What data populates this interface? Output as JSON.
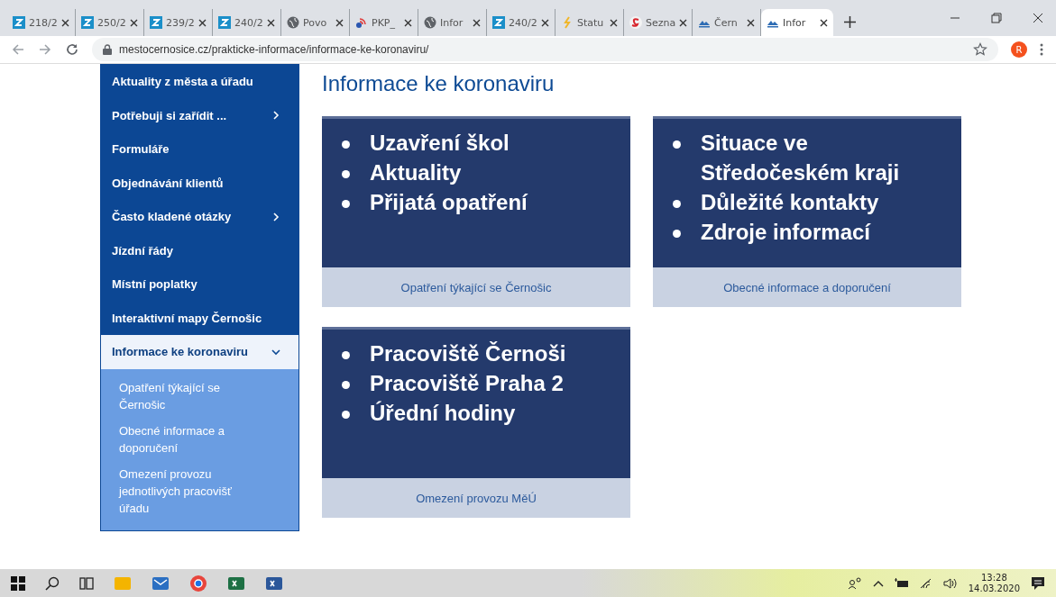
{
  "browser": {
    "tabs": [
      {
        "kind": "z",
        "label": "218/2",
        "selected": false
      },
      {
        "kind": "z",
        "label": "250/2",
        "selected": false
      },
      {
        "kind": "z",
        "label": "239/2",
        "selected": false
      },
      {
        "kind": "z",
        "label": "240/2",
        "selected": false
      },
      {
        "kind": "globe",
        "label": "Povo",
        "selected": false
      },
      {
        "kind": "feed",
        "label": "PKP_",
        "selected": false
      },
      {
        "kind": "globe",
        "label": "Infor",
        "selected": false
      },
      {
        "kind": "z",
        "label": "240/2",
        "selected": false
      },
      {
        "kind": "link",
        "label": "Statu",
        "selected": false
      },
      {
        "kind": "s",
        "label": "Sezna",
        "selected": false
      },
      {
        "kind": "town",
        "label": "Čern",
        "selected": false
      },
      {
        "kind": "town",
        "label": "Infor",
        "selected": true
      }
    ],
    "url": "mestocernosice.cz/prakticke-informace/informace-ke-koronaviru/",
    "profile_initial": "R"
  },
  "sidebar": {
    "items": [
      {
        "label": "Aktuality z města a úřadu",
        "selected": false
      },
      {
        "label": "Potřebuji si zařídit ...",
        "expanded": false,
        "selected": false
      },
      {
        "label": "Formuláře",
        "selected": false
      },
      {
        "label": "Objednávání klientů",
        "selected": false
      },
      {
        "label": "Často kladené otázky",
        "expanded": false,
        "selected": false
      },
      {
        "label": "Jízdní řády",
        "selected": false
      },
      {
        "label": "Místní poplatky",
        "selected": false
      },
      {
        "label": "Interaktivní mapy Černošic",
        "selected": false
      },
      {
        "label": "Informace ke koronaviru",
        "expanded": true,
        "selected": true,
        "children": [
          {
            "label": "Opatření týkající se Černošic"
          },
          {
            "label": "Obecné informace a doporučení"
          },
          {
            "label": "Omezení provozu jednotlivých pracovišť úřadu"
          }
        ]
      }
    ]
  },
  "main": {
    "title": "Informace ke koronaviru",
    "cards": [
      {
        "bullets": [
          "Uzavření škol",
          "Aktuality",
          "Přijatá opatření"
        ],
        "caption": "Opatření týkající se Černošic"
      },
      {
        "bullets": [
          "Situace ve Středočeském kraji",
          "Důležité kontakty",
          "Zdroje informací"
        ],
        "caption": "Obecné informace a doporučení"
      },
      {
        "bullets": [
          "Pracoviště Černoši",
          "Pracoviště Praha 2",
          "Úřední hodiny"
        ],
        "caption": "Omezení provozu MěÚ"
      }
    ]
  },
  "taskbar": {
    "apps": [
      {
        "kind": "windows"
      },
      {
        "kind": "search"
      },
      {
        "kind": "taskview"
      },
      {
        "kind": "explorer"
      },
      {
        "kind": "mail"
      },
      {
        "kind": "chrome"
      },
      {
        "kind": "excel"
      },
      {
        "kind": "word"
      }
    ],
    "time": "13:28",
    "date": "14.03.2020"
  }
}
